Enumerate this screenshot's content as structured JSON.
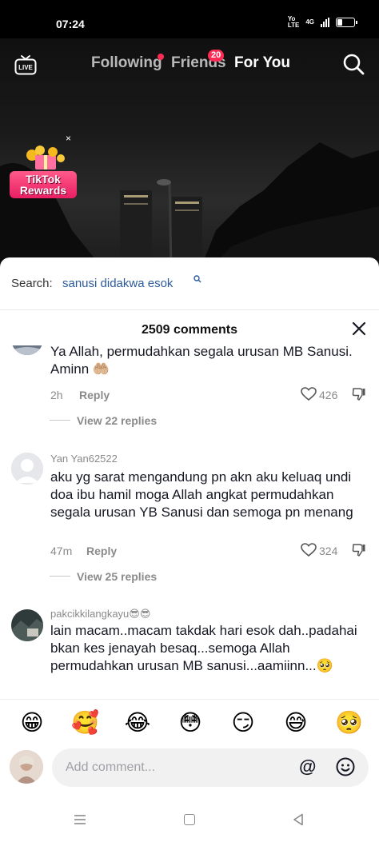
{
  "status_bar": {
    "time": "07:24",
    "net_top": "Yo",
    "net_bottom": "LTE",
    "net_type": "4G",
    "battery_level": 0.3
  },
  "top_nav": {
    "live_label": "LIVE",
    "tabs": [
      {
        "label": "Following",
        "active": false
      },
      {
        "label": "Friends",
        "active": false,
        "badge": "20"
      },
      {
        "label": "For You",
        "active": true
      }
    ]
  },
  "rewards": {
    "line1": "TikTok",
    "line2": "Rewards",
    "close_glyph": "×"
  },
  "search": {
    "prefix": "Search:",
    "term": "sanusi didakwa esok"
  },
  "comments_header": {
    "count_text": "2509 comments"
  },
  "comments": [
    {
      "username": "",
      "text": "Ya Allah, permudahkan segala urusan MB Sanusi. Aminn 🤲🏼",
      "time": "2h",
      "reply_label": "Reply",
      "likes": "426",
      "view_replies": "View 22 replies"
    },
    {
      "username": "Yan Yan62522",
      "text": "aku yg sarat mengandung pn akn aku keluaq undi doa ibu hamil moga Allah angkat permudahkan segala urusan YB Sanusi dan semoga pn menang",
      "time": "47m",
      "reply_label": "Reply",
      "likes": "324",
      "view_replies": "View 25 replies"
    },
    {
      "username": "pakcikkilangkayu😎😎",
      "text": "lain macam..macam takdak hari esok dah..padahai bkan kes jenayah besaq...semoga Allah permudahkan urusan MB sanusi...aamiinn...🥺"
    }
  ],
  "emoji_bar": [
    "😁",
    "🥰",
    "😂",
    "😳",
    "😏",
    "😅",
    "🥺"
  ],
  "comment_input": {
    "placeholder": "Add comment...",
    "mention_glyph": "@"
  },
  "colors": {
    "accent": "#fe2c55",
    "search_term": "#2b5a9b",
    "text_primary": "#161823",
    "text_secondary": "#8a8a8a"
  }
}
